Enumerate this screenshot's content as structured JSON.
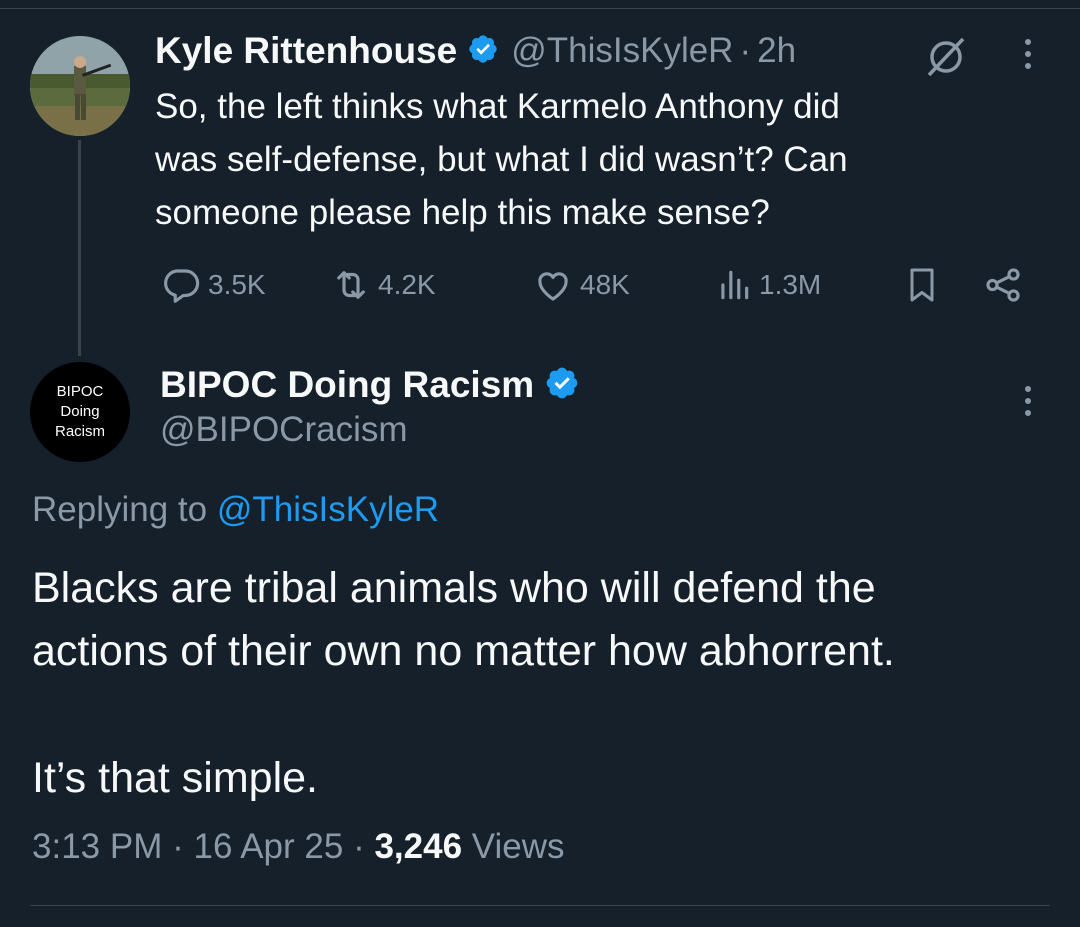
{
  "theme": {
    "background": "#15202b",
    "text_primary": "#f7f9f9",
    "text_secondary": "#8b98a5",
    "accent": "#1d9bf0",
    "divider": "#38444d"
  },
  "parent_tweet": {
    "author_name": "Kyle Rittenhouse",
    "handle": "@ThisIsKyleR",
    "separator": "·",
    "time": "2h",
    "text_lines": [
      "So, the left thinks what Karmelo Anthony  did",
      "was self-defense, but what I did wasn’t? Can",
      "someone please help this make sense?"
    ],
    "actions": {
      "replies": "3.5K",
      "reposts": "4.2K",
      "likes": "48K",
      "views": "1.3M"
    },
    "icons": [
      "verified-badge-icon",
      "grok-icon",
      "more-icon",
      "reply-icon",
      "repost-icon",
      "like-icon",
      "views-icon",
      "bookmark-icon",
      "share-icon"
    ]
  },
  "reply_tweet": {
    "avatar_text": [
      "BIPOC",
      "Doing",
      "Racism"
    ],
    "author_name": "BIPOC Doing Racism",
    "handle": "@BIPOCracism",
    "replying_prefix": "Replying to",
    "replying_handle": "@ThisIsKyleR",
    "text_lines": [
      "Blacks are tribal animals who will defend the",
      "actions of their own no matter how abhorrent."
    ],
    "text_line_3": "It’s that simple.",
    "meta": {
      "time": "3:13 PM",
      "sep1": "·",
      "date": "16 Apr 25",
      "sep2": "·",
      "views_count": "3,246",
      "views_label": "Views"
    }
  }
}
